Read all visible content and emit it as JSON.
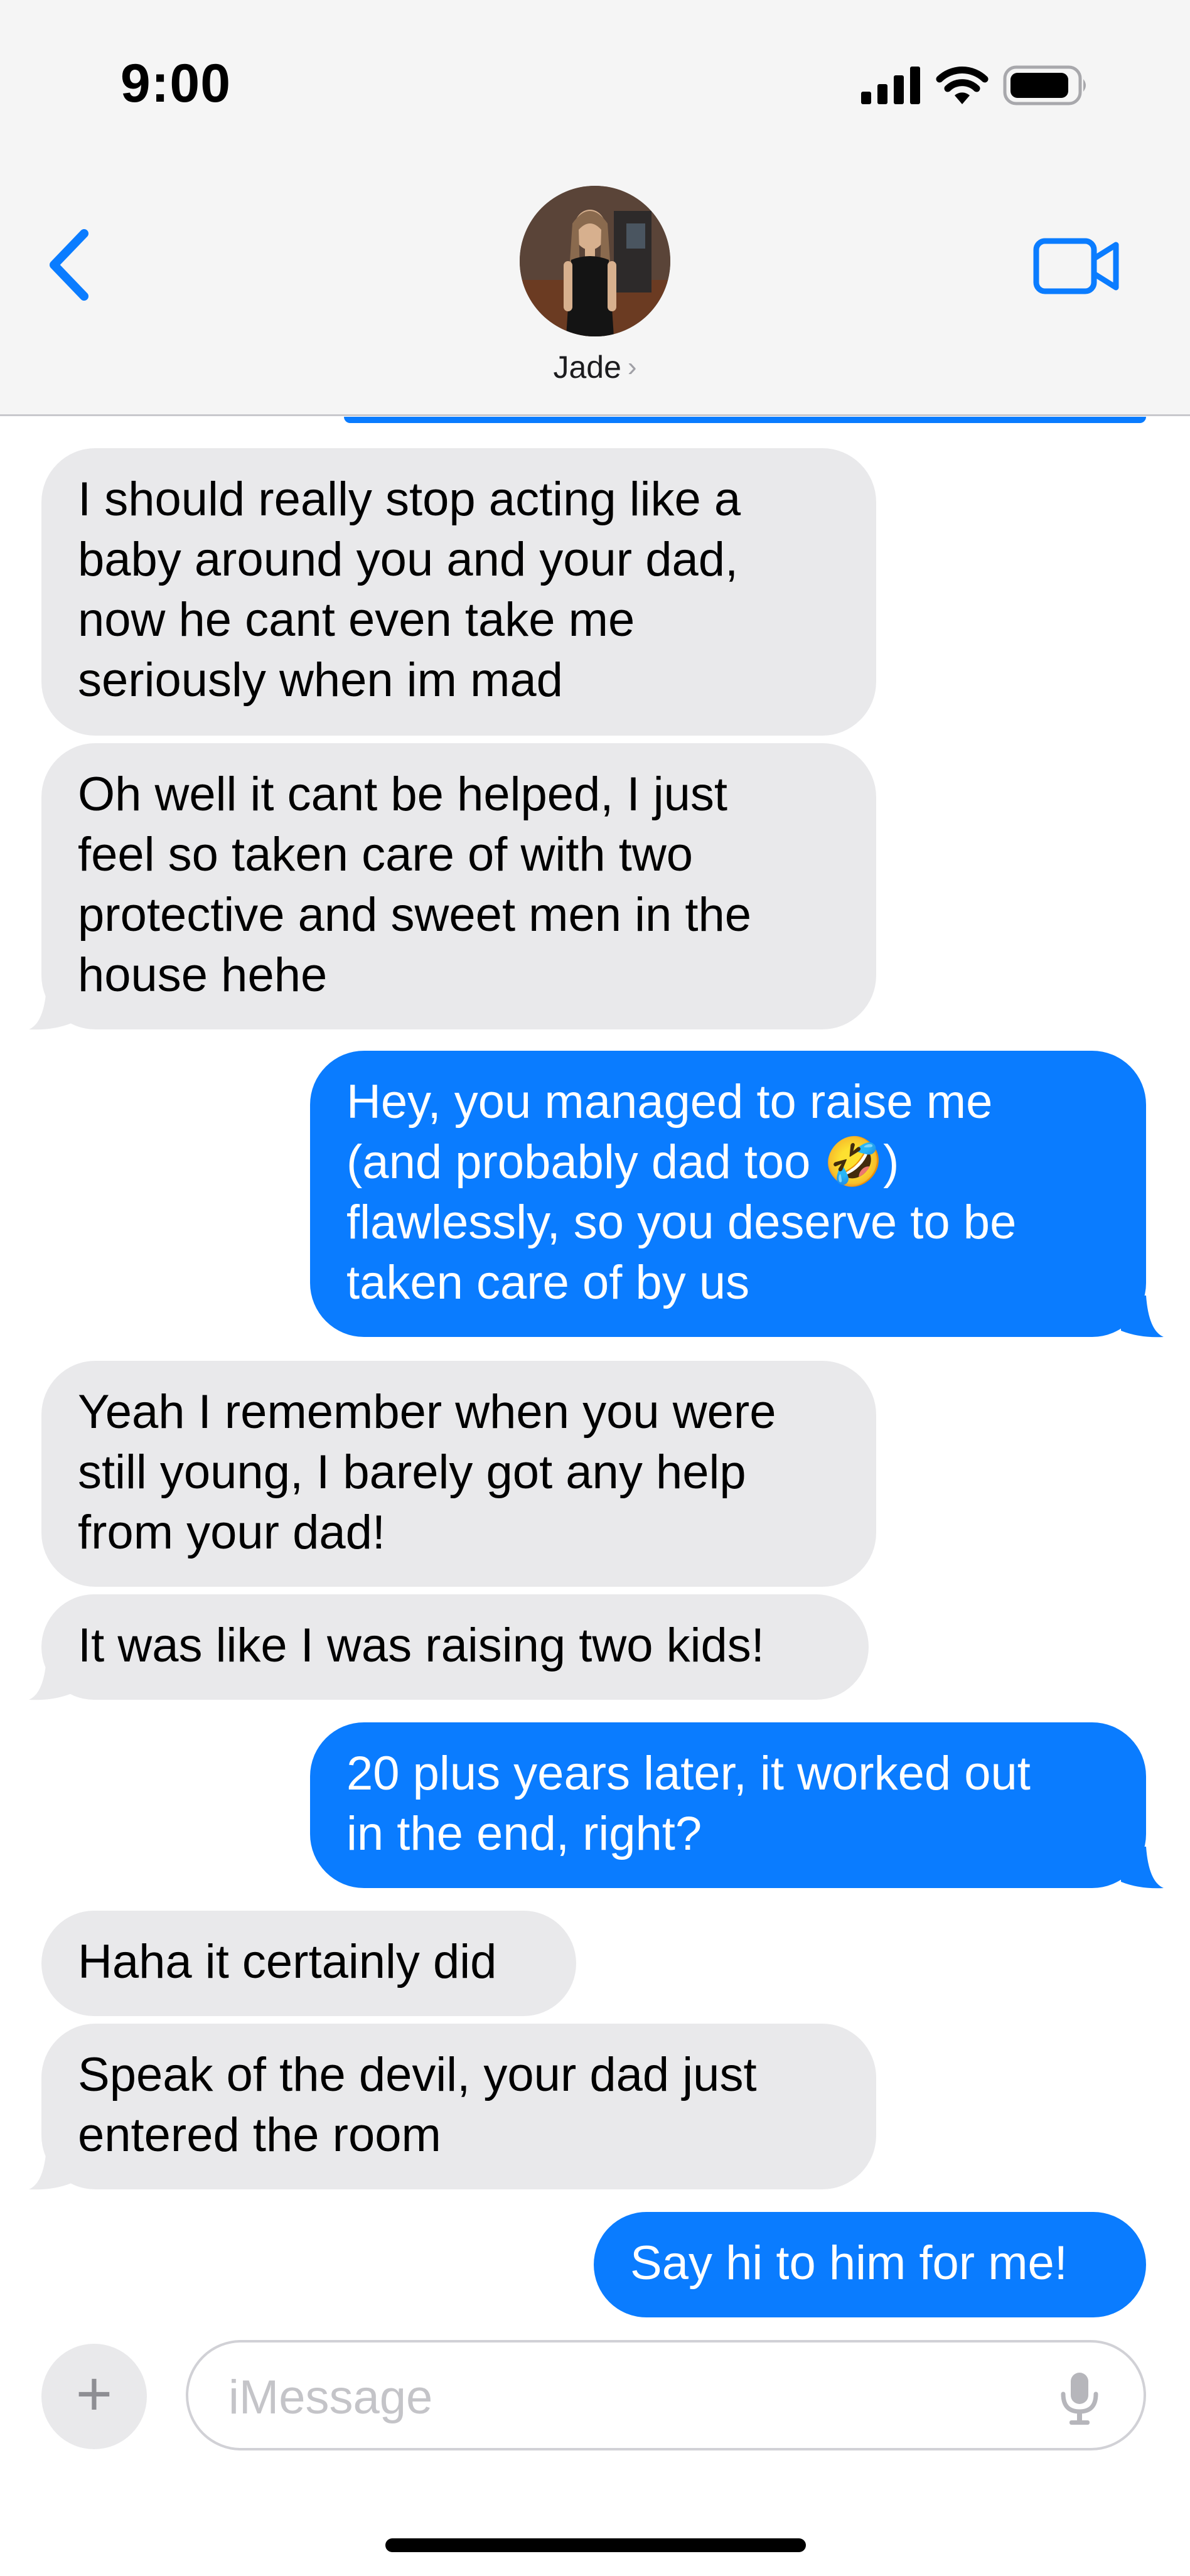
{
  "status_bar": {
    "time": "9:00"
  },
  "header": {
    "contact_name": "Jade",
    "chevron": "›",
    "back_icon": "chevron-left-icon",
    "video_icon": "video-camera-icon"
  },
  "messages": [
    {
      "direction": "incoming",
      "text": "I should really stop acting like a\nbaby around you and your dad,\nnow he cant even take me\nseriously when im mad"
    },
    {
      "direction": "incoming",
      "text": "Oh well it cant be helped, I just\nfeel so taken care of with two\nprotective and sweet men in the\nhouse hehe"
    },
    {
      "direction": "outgoing",
      "text": "Hey, you managed to raise me\n(and probably dad too 🤣)\nflawlessly, so you deserve to be\ntaken care of by us"
    },
    {
      "direction": "incoming",
      "text": "Yeah I remember when you were\nstill young, I barely got any help\nfrom your dad!"
    },
    {
      "direction": "incoming",
      "text": "It was like I was raising two kids!"
    },
    {
      "direction": "outgoing",
      "text": "20 plus years later, it worked out\nin the end, right?"
    },
    {
      "direction": "incoming",
      "text": "Haha it certainly did"
    },
    {
      "direction": "incoming",
      "text": "Speak of the devil, your dad just\nentered the room"
    },
    {
      "direction": "outgoing",
      "text": "Say hi to him for me!"
    }
  ],
  "composer": {
    "plus_label": "+",
    "placeholder": "iMessage",
    "mic_icon": "microphone-icon"
  },
  "colors": {
    "outgoing_bubble": "#0a7cff",
    "incoming_bubble": "#e9e9eb",
    "accent": "#0a7cff"
  }
}
